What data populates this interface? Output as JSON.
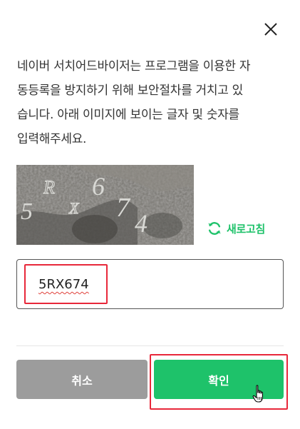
{
  "dialog": {
    "message_lines": [
      "네이버 서치어드바이저는 프로그램을 이용한 자",
      "동등록을 방지하기 위해 보안절차를 거치고 있",
      "습니다. 아래 이미지에 보이는 글자 및 숫자를",
      "입력해주세요."
    ]
  },
  "captcha": {
    "characters": [
      "5",
      "R",
      "X",
      "6",
      "7",
      "4"
    ]
  },
  "refresh": {
    "label": "새로고침",
    "icon": "refresh-icon"
  },
  "input": {
    "value": "5RX674"
  },
  "buttons": {
    "cancel": "취소",
    "confirm": "확인"
  },
  "colors": {
    "accent": "#1ec26a",
    "cancel_bg": "#9c9c9c",
    "highlight": "#e8283a"
  }
}
